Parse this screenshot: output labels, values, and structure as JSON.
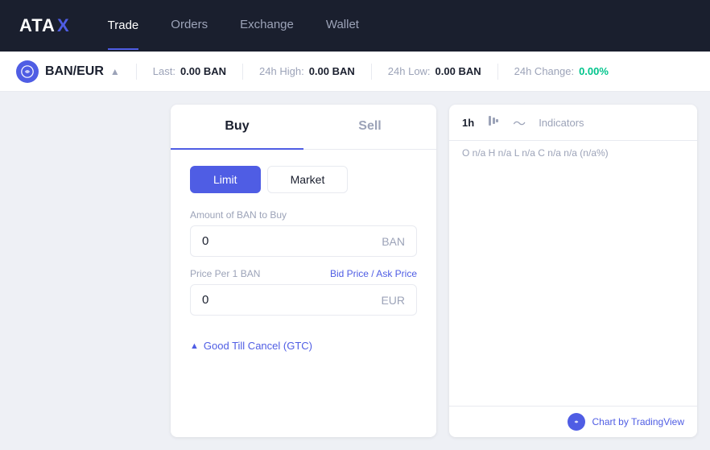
{
  "brand": {
    "name_prefix": "ATA",
    "name_suffix": "X"
  },
  "nav": {
    "links": [
      {
        "id": "trade",
        "label": "Trade",
        "active": true
      },
      {
        "id": "orders",
        "label": "Orders",
        "active": false
      },
      {
        "id": "exchange",
        "label": "Exchange",
        "active": false
      },
      {
        "id": "wallet",
        "label": "Wallet",
        "active": false
      }
    ]
  },
  "ticker": {
    "icon_text": "B",
    "pair": "BAN/EUR",
    "last_label": "Last:",
    "last_value": "0.00 BAN",
    "high_label": "24h High:",
    "high_value": "0.00 BAN",
    "low_label": "24h Low:",
    "low_value": "0.00 BAN",
    "change_label": "24h Change:",
    "change_value": "0.00%"
  },
  "trade_panel": {
    "buy_label": "Buy",
    "sell_label": "Sell",
    "order_types": [
      {
        "id": "limit",
        "label": "Limit",
        "active": true
      },
      {
        "id": "market",
        "label": "Market",
        "active": false
      }
    ],
    "amount_label": "Amount of BAN to Buy",
    "amount_value": "0",
    "amount_unit": "BAN",
    "price_label": "Price Per 1 BAN",
    "price_link": "Bid Price / Ask Price",
    "price_value": "0",
    "price_unit": "EUR",
    "gtc_label": "Good Till Cancel (GTC)"
  },
  "chart": {
    "time_label": "1h",
    "chart_type_icon": "⇅",
    "wave_icon": "~",
    "indicators_label": "Indicators",
    "stats": "O n/a  H n/a  L n/a  C n/a  n/a (n/a%)",
    "footer_icon": "B",
    "footer_label": "Chart by TradingView"
  }
}
